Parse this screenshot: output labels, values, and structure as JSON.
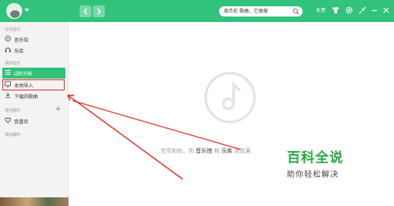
{
  "titlebar": {
    "search_placeholder": "周杰伦 歌曲，它很搜",
    "feedback_label": "反馈"
  },
  "sidebar": {
    "online_music_header": "在线音乐",
    "music_hall": "音乐馆",
    "music_library": "乐库",
    "my_music_header": "我的音乐",
    "trial_list": "试听列表",
    "local_import": "本地导入",
    "downloaded_songs": "下载的歌曲",
    "my_created_header": "我创建的",
    "my_favorites": "我喜欢",
    "my_collected_header": "我收藏的"
  },
  "main": {
    "empty_prefix": "空空如也，到",
    "empty_link1": "音乐馆",
    "empty_mid": "和",
    "empty_link2": "乐库",
    "empty_suffix": "添加满"
  },
  "watermark": {
    "title": "百科全说",
    "subtitle": "助你轻松解决"
  },
  "colors": {
    "accent": "#31c27c",
    "annotation": "#e62a22",
    "watermark": "#2aa843"
  }
}
